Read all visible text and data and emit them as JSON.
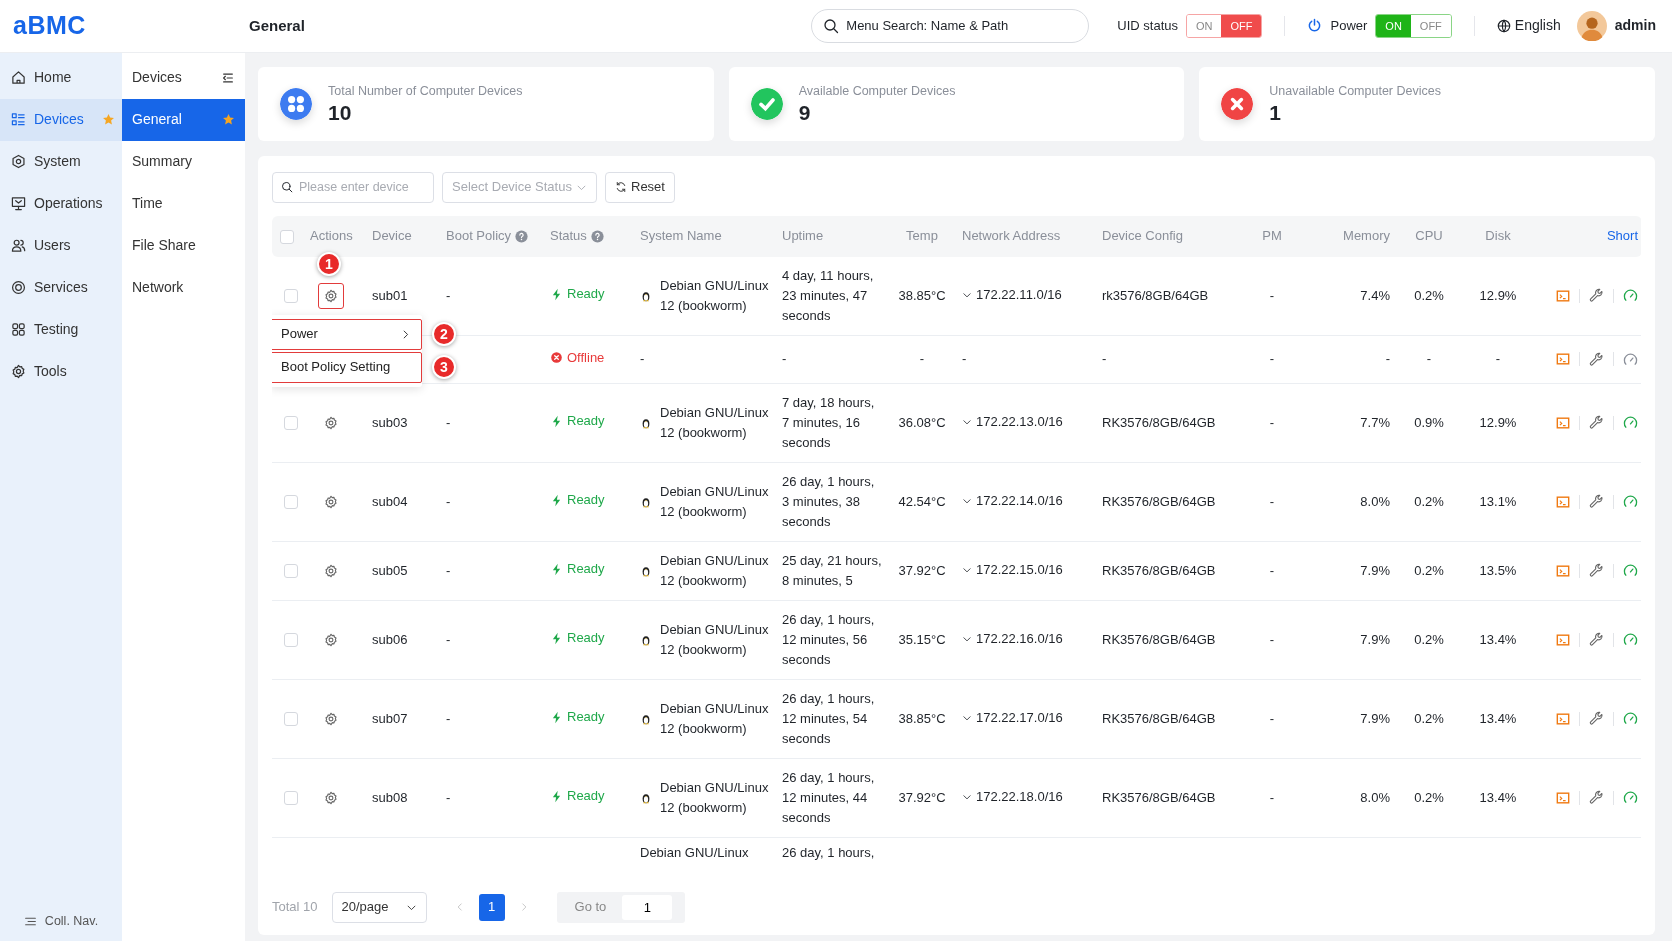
{
  "logo": "aBMC",
  "page_title": "General",
  "search": {
    "placeholder": "Menu Search: Name & Path"
  },
  "uid_status": {
    "label": "UID status",
    "options": [
      {
        "label": "ON",
        "selected": false
      },
      {
        "label": "OFF",
        "selected": true
      }
    ]
  },
  "power": {
    "label": "Power",
    "options": [
      {
        "label": "ON",
        "selected": true
      },
      {
        "label": "OFF",
        "selected": false
      }
    ]
  },
  "language": "English",
  "user": "admin",
  "nav": [
    {
      "label": "Home",
      "selected": false,
      "favorite": false
    },
    {
      "label": "Devices",
      "selected": true,
      "favorite": true
    },
    {
      "label": "System",
      "selected": false,
      "favorite": false
    },
    {
      "label": "Operations",
      "selected": false,
      "favorite": false
    },
    {
      "label": "Users",
      "selected": false,
      "favorite": false
    },
    {
      "label": "Services",
      "selected": false,
      "favorite": false
    },
    {
      "label": "Testing",
      "selected": false,
      "favorite": false
    },
    {
      "label": "Tools",
      "selected": false,
      "favorite": false
    }
  ],
  "subnav": {
    "title": "Devices",
    "items": [
      {
        "label": "General",
        "selected": true,
        "favorite": true
      },
      {
        "label": "Summary",
        "selected": false,
        "favorite": false
      },
      {
        "label": "Time",
        "selected": false,
        "favorite": false
      },
      {
        "label": "File Share",
        "selected": false,
        "favorite": false
      },
      {
        "label": "Network",
        "selected": false,
        "favorite": false
      }
    ]
  },
  "collapse_nav": "Coll. Nav.",
  "stats": [
    {
      "label": "Total Number of Computer Devices",
      "value": "10",
      "color": "#3d7bf0"
    },
    {
      "label": "Available Computer Devices",
      "value": "9",
      "color": "#22c55e"
    },
    {
      "label": "Unavailable Computer Devices",
      "value": "1",
      "color": "#f04444"
    }
  ],
  "filters": {
    "search_placeholder": "Please enter device",
    "status_placeholder": "Select Device Status",
    "reset": "Reset"
  },
  "table": {
    "header_checked": false,
    "columns": [
      {
        "label": "Actions",
        "help": false
      },
      {
        "label": "Device",
        "help": false
      },
      {
        "label": "Boot Policy",
        "help": true
      },
      {
        "label": "Status",
        "help": true
      },
      {
        "label": "System Name",
        "help": false
      },
      {
        "label": "Uptime",
        "help": false
      },
      {
        "label": "Temp",
        "help": false
      },
      {
        "label": "Network Address",
        "help": false
      },
      {
        "label": "Device Config",
        "help": false
      },
      {
        "label": "PM",
        "help": false
      },
      {
        "label": "Memory",
        "help": false
      },
      {
        "label": "CPU",
        "help": false
      },
      {
        "label": "Disk",
        "help": false
      }
    ],
    "short_link": "Short",
    "rows": [
      {
        "checked": false,
        "device": "sub01",
        "boot_policy": "-",
        "status": "Ready",
        "kind": "ready",
        "system": "Debian GNU/Linux 12 (bookworm)",
        "uptime": "4 day, 11 hours, 23 minutes, 47 seconds",
        "temp": "38.85°C",
        "expanded": false,
        "network": "172.22.11.0/16",
        "config": "rk3576/8GB/64GB",
        "pm": "-",
        "memory": "7.4%",
        "cpu": "0.2%",
        "disk": "12.9%"
      },
      {
        "status": "Offline",
        "kind": "offline",
        "system": "-",
        "uptime": "-",
        "temp": "-",
        "network": "-",
        "config": "-",
        "pm": "-",
        "memory": "-",
        "cpu": "-",
        "disk": "-"
      },
      {
        "checked": false,
        "device": "sub03",
        "boot_policy": "-",
        "status": "Ready",
        "kind": "ready",
        "system": "Debian GNU/Linux 12 (bookworm)",
        "uptime": "7 day, 18 hours, 7 minutes, 16 seconds",
        "temp": "36.08°C",
        "expanded": false,
        "network": "172.22.13.0/16",
        "config": "RK3576/8GB/64GB",
        "pm": "-",
        "memory": "7.7%",
        "cpu": "0.9%",
        "disk": "12.9%"
      },
      {
        "checked": false,
        "device": "sub04",
        "boot_policy": "-",
        "status": "Ready",
        "kind": "ready",
        "system": "Debian GNU/Linux 12 (bookworm)",
        "uptime": "26 day, 1 hours, 3 minutes, 38 seconds",
        "temp": "42.54°C",
        "expanded": false,
        "network": "172.22.14.0/16",
        "config": "RK3576/8GB/64GB",
        "pm": "-",
        "memory": "8.0%",
        "cpu": "0.2%",
        "disk": "13.1%"
      },
      {
        "checked": false,
        "device": "sub05",
        "boot_policy": "-",
        "status": "Ready",
        "kind": "ready",
        "system": "Debian GNU/Linux 12 (bookworm)",
        "uptime": "25 day, 21 hours, 8 minutes, 5",
        "temp": "37.92°C",
        "expanded": false,
        "network": "172.22.15.0/16",
        "config": "RK3576/8GB/64GB",
        "pm": "-",
        "memory": "7.9%",
        "cpu": "0.2%",
        "disk": "13.5%"
      },
      {
        "checked": false,
        "device": "sub06",
        "boot_policy": "-",
        "status": "Ready",
        "kind": "ready",
        "system": "Debian GNU/Linux 12 (bookworm)",
        "uptime": "26 day, 1 hours, 12 minutes, 56 seconds",
        "temp": "35.15°C",
        "expanded": false,
        "network": "172.22.16.0/16",
        "config": "RK3576/8GB/64GB",
        "pm": "-",
        "memory": "7.9%",
        "cpu": "0.2%",
        "disk": "13.4%"
      },
      {
        "checked": false,
        "device": "sub07",
        "boot_policy": "-",
        "status": "Ready",
        "kind": "ready",
        "system": "Debian GNU/Linux 12 (bookworm)",
        "uptime": "26 day, 1 hours, 12 minutes, 54 seconds",
        "temp": "38.85°C",
        "expanded": false,
        "network": "172.22.17.0/16",
        "config": "RK3576/8GB/64GB",
        "pm": "-",
        "memory": "7.9%",
        "cpu": "0.2%",
        "disk": "13.4%"
      },
      {
        "checked": false,
        "device": "sub08",
        "boot_policy": "-",
        "status": "Ready",
        "kind": "ready",
        "system": "Debian GNU/Linux 12 (bookworm)",
        "uptime": "26 day, 1 hours, 12 minutes, 44 seconds",
        "temp": "37.92°C",
        "expanded": false,
        "network": "172.22.18.0/16",
        "config": "RK3576/8GB/64GB",
        "pm": "-",
        "memory": "8.0%",
        "cpu": "0.2%",
        "disk": "13.4%"
      },
      {
        "system": "Debian GNU/Linux",
        "uptime": "26 day, 1 hours,"
      }
    ]
  },
  "action_menu": {
    "items": [
      {
        "label": "Power",
        "submenu": true,
        "marker": "2"
      },
      {
        "label": "Boot Policy Setting",
        "submenu": false,
        "marker": "3"
      }
    ],
    "gear_marker": "1"
  },
  "pagination": {
    "total": "Total 10",
    "page_size": "20/page",
    "pages": [
      {
        "label": "1",
        "selected": true
      }
    ],
    "goto_label": "Go to",
    "goto_value": "1"
  }
}
